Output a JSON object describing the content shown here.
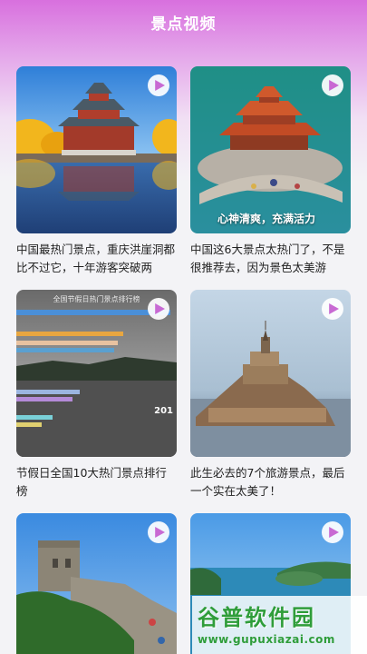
{
  "page_title": "景点视频",
  "cards": [
    {
      "caption": "中国最热门景点，重庆洪崖洞都比不过它，十年游客突破两"
    },
    {
      "caption": "中国这6大景点太热门了，不是很推荐去，因为景色太美游",
      "overlay": "心神清爽，充满活力"
    },
    {
      "caption": "节假日全国10大热门景点排行榜",
      "chart_title": "全国节假日热门景点排行榜",
      "year": "201"
    },
    {
      "caption": "此生必去的7个旅游景点，最后一个实在太美了！"
    },
    {
      "caption": ""
    },
    {
      "caption": ""
    }
  ],
  "icons": {
    "play": "play-icon"
  },
  "watermark": {
    "main": "谷普软件园",
    "url": "www.gupuxiazai.com"
  },
  "colors": {
    "header": "#d870de",
    "watermark": "#2f9d3a"
  }
}
